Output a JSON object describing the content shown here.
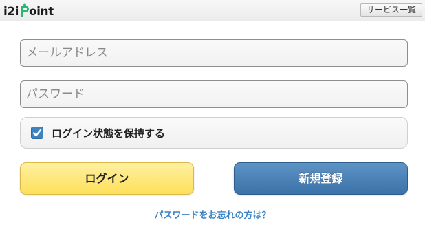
{
  "header": {
    "logo_text_a": "i2i",
    "logo_text_b": "oint",
    "service_list_label": "サービス一覧"
  },
  "form": {
    "email_placeholder": "メールアドレス",
    "password_placeholder": "パスワード",
    "remember_label": "ログイン状態を保持する",
    "remember_checked": true,
    "login_label": "ログイン",
    "signup_label": "新規登録",
    "forgot_label": "パスワードをお忘れの方は？"
  },
  "colors": {
    "logo_green": "#2bb673",
    "login_button": "#fde05a",
    "signup_button": "#3b72a8",
    "checkbox": "#3d83bf",
    "link": "#3a84c6"
  },
  "icons": {
    "logo": "i2i-point-logo",
    "checkbox": "checkmark-icon"
  }
}
